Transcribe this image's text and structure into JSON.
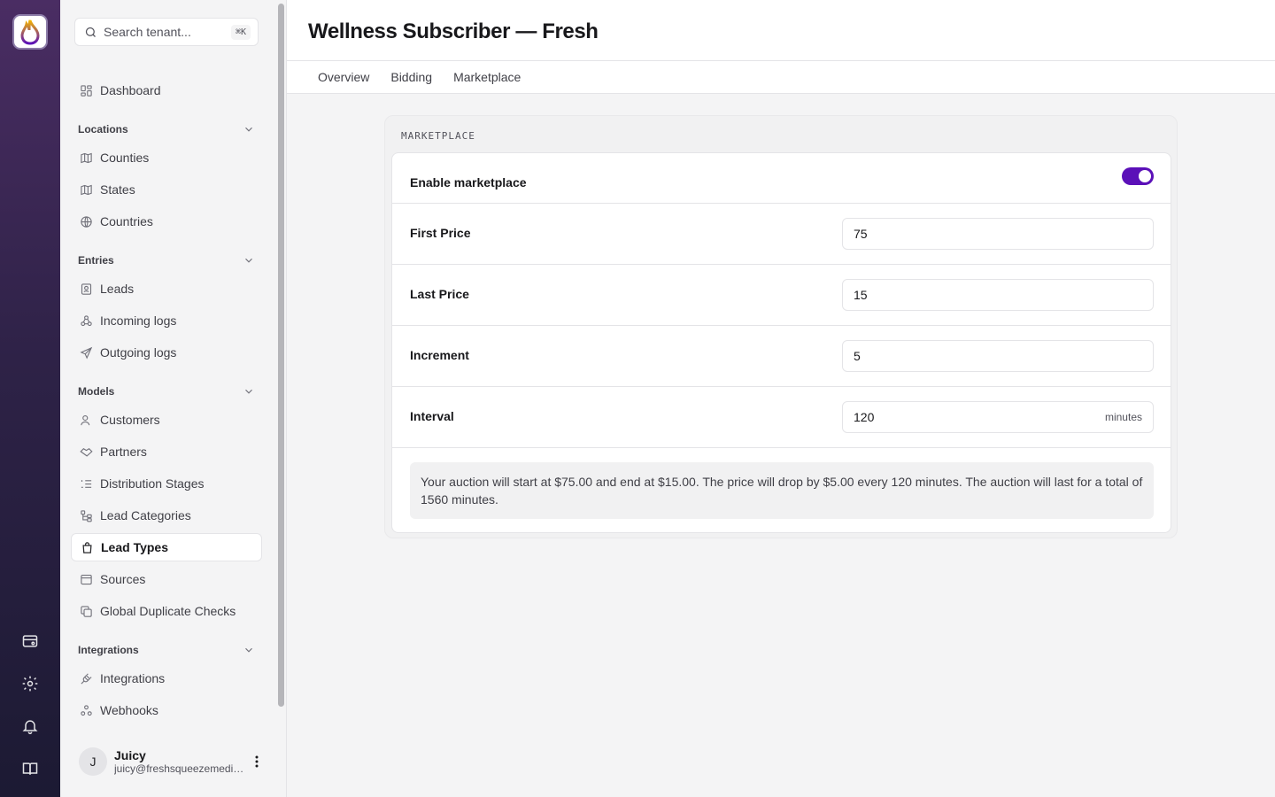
{
  "rail": {
    "logo_color": "#5b10b8",
    "icons": [
      "wallet-icon",
      "gear-icon",
      "bell-icon",
      "book-icon"
    ]
  },
  "sidebar": {
    "search": {
      "placeholder": "Search tenant...",
      "shortcut": "⌘K"
    },
    "dashboard": {
      "label": "Dashboard",
      "icon": "dashboard-icon"
    },
    "groups": [
      {
        "title": "Locations",
        "items": [
          {
            "label": "Counties",
            "icon": "map-icon"
          },
          {
            "label": "States",
            "icon": "map-fold-icon"
          },
          {
            "label": "Countries",
            "icon": "globe-icon"
          }
        ]
      },
      {
        "title": "Entries",
        "items": [
          {
            "label": "Leads",
            "icon": "contact-icon"
          },
          {
            "label": "Incoming logs",
            "icon": "webhook-icon"
          },
          {
            "label": "Outgoing logs",
            "icon": "send-icon"
          }
        ]
      },
      {
        "title": "Models",
        "items": [
          {
            "label": "Customers",
            "icon": "users-icon"
          },
          {
            "label": "Partners",
            "icon": "handshake-icon"
          },
          {
            "label": "Distribution Stages",
            "icon": "list-ordered-icon"
          },
          {
            "label": "Lead Categories",
            "icon": "tree-icon"
          },
          {
            "label": "Lead Types",
            "icon": "shopping-bag-icon",
            "active": true
          },
          {
            "label": "Sources",
            "icon": "window-icon"
          },
          {
            "label": "Global Duplicate Checks",
            "icon": "copy-icon"
          }
        ]
      },
      {
        "title": "Integrations",
        "items": [
          {
            "label": "Integrations",
            "icon": "plug-icon"
          },
          {
            "label": "Webhooks",
            "icon": "webhook-icon"
          }
        ]
      }
    ],
    "user": {
      "initial": "J",
      "name": "Juicy",
      "email": "juicy@freshsqueezemedia.com"
    }
  },
  "page": {
    "title": "Wellness Subscriber — Fresh",
    "tabs": [
      "Overview",
      "Bidding",
      "Marketplace"
    ]
  },
  "marketplace": {
    "section_label": "MARKETPLACE",
    "enable_label": "Enable marketplace",
    "enabled": true,
    "accent_color": "#5b10b8",
    "first_price_label": "First Price",
    "first_price": "75",
    "last_price_label": "Last Price",
    "last_price": "15",
    "increment_label": "Increment",
    "increment": "5",
    "interval_label": "Interval",
    "interval": "120",
    "interval_unit": "minutes",
    "summary": "Your auction will start at $75.00 and end at $15.00. The price will drop by $5.00 every 120 minutes. The auction will last for a total of 1560 minutes."
  }
}
